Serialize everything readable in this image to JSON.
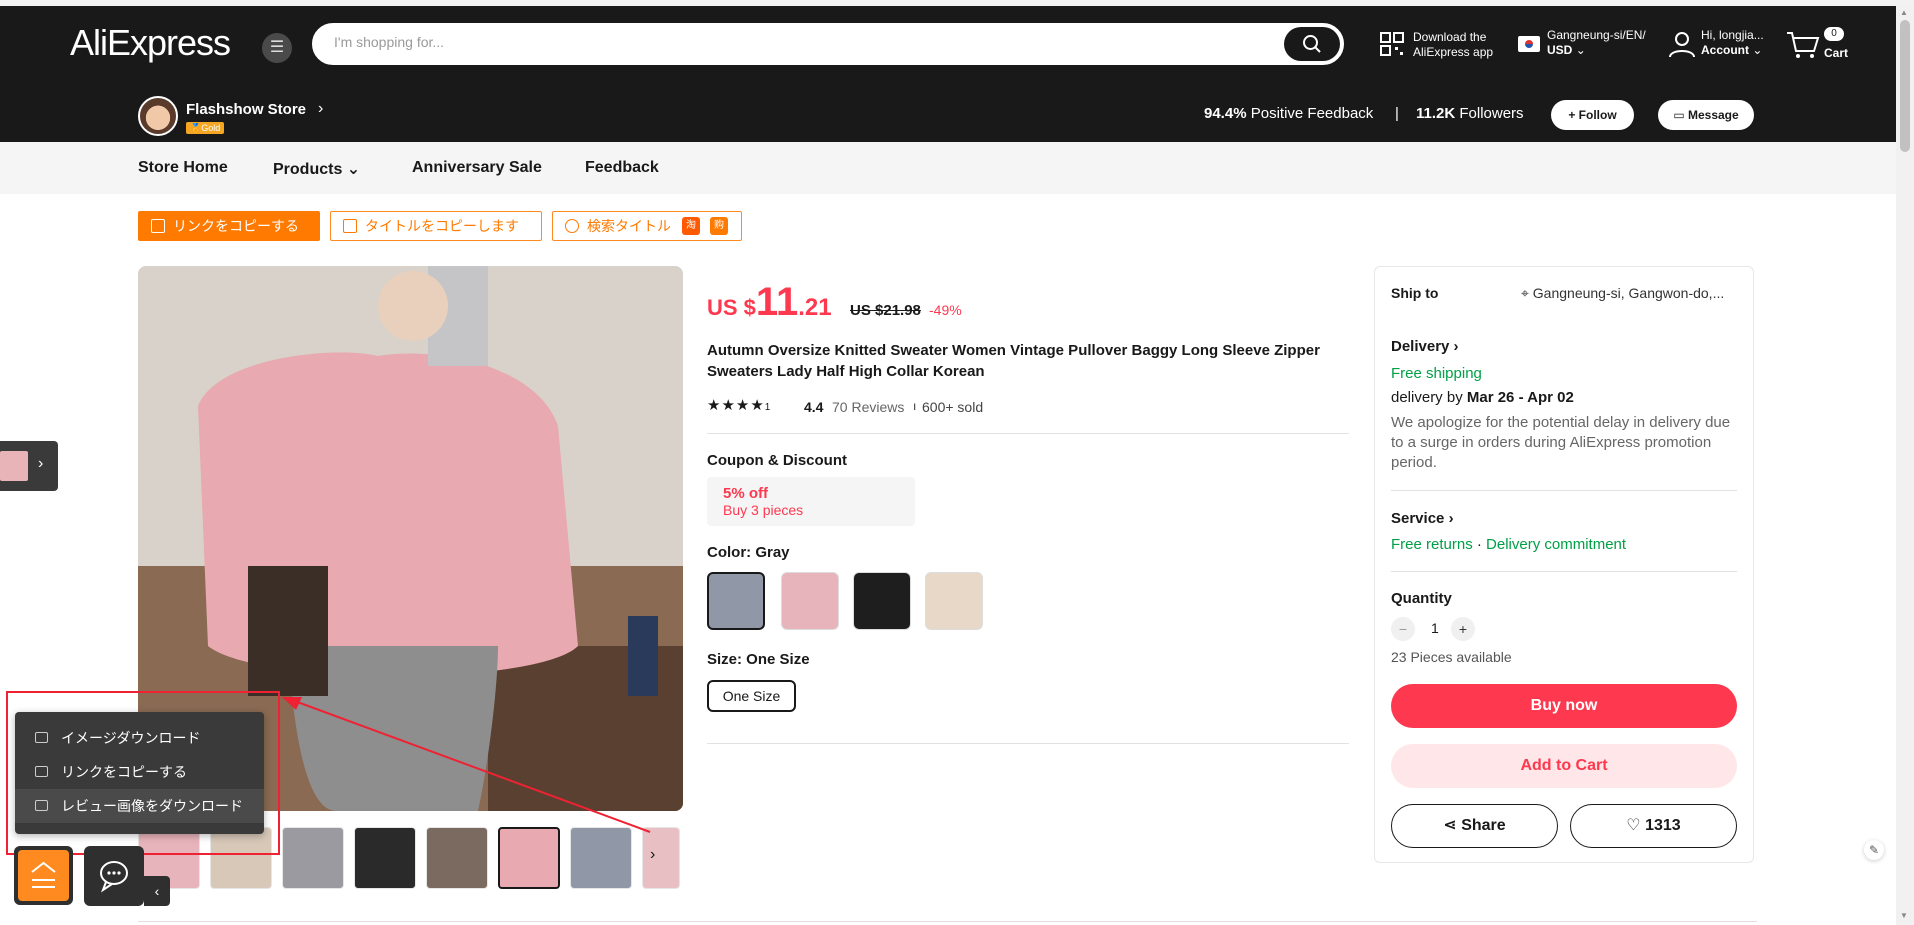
{
  "header": {
    "logo": "AliExpress",
    "search_placeholder": "I'm shopping for...",
    "download_line1": "Download the",
    "download_line2": "AliExpress app",
    "location_line1": "Gangneung-si/EN/",
    "location_line2": "USD",
    "account_line1": "Hi, longjia...",
    "account_line2": "Account",
    "cart_count": "0",
    "cart_label": "Cart"
  },
  "store": {
    "name": "Flashshow Store",
    "badge": "Gold",
    "positive_pct": "94.4%",
    "positive_label": "Positive Feedback",
    "separator": "|",
    "followers_count": "11.2K",
    "followers_label": "Followers",
    "follow_label": "+ Follow",
    "message_label": "Message"
  },
  "store_nav": [
    "Store Home",
    "Products",
    "Anniversary Sale",
    "Feedback"
  ],
  "ext_buttons": {
    "copy_link": "リンクをコピーする",
    "copy_title": "タイトルをコピーします",
    "search_title": "検索タイトル"
  },
  "context_menu": {
    "items": [
      "イメージダウンロード",
      "リンクをコピーする",
      "レビュー画像をダウンロード"
    ]
  },
  "product": {
    "price_currency": "US $",
    "price_int": "11",
    "price_dec": ".21",
    "original_price": "US $21.98",
    "discount": "-49%",
    "title": "Autumn Oversize Knitted Sweater Women Vintage Pullover Baggy Long Sleeve Zipper Sweaters Lady Half High Collar Korean",
    "stars": "★★★★",
    "rating": "4.4",
    "reviews": "70 Reviews",
    "sep": "ı",
    "sold": "600+ sold",
    "coupon_label": "Coupon & Discount",
    "coupon_line1": "5% off",
    "coupon_line2": "Buy 3 pieces",
    "color_label": "Color: Gray",
    "size_label": "Size: One Size",
    "size_option": "One Size"
  },
  "side_panel": {
    "ship_to_label": "Ship to",
    "ship_to_value": "Gangneung-si, Gangwon-do,...",
    "delivery_label": "Delivery",
    "free_shipping": "Free shipping",
    "delivery_by": "delivery by",
    "delivery_dates": "Mar 26 - Apr 02",
    "apology": "We apologize for the potential delay in delivery due to a surge in orders during AliExpress promotion period.",
    "service_label": "Service",
    "free_returns": "Free returns",
    "dot": "·",
    "delivery_commitment": "Delivery commitment",
    "quantity_label": "Quantity",
    "quantity_value": "1",
    "pieces_available": "23 Pieces available",
    "buy_now": "Buy now",
    "add_to_cart": "Add to Cart",
    "share": "Share",
    "wishlist_count": "1313"
  },
  "colors": {
    "accent": "#fd384f",
    "orange": "#ff7a00",
    "green": "#00a046"
  }
}
